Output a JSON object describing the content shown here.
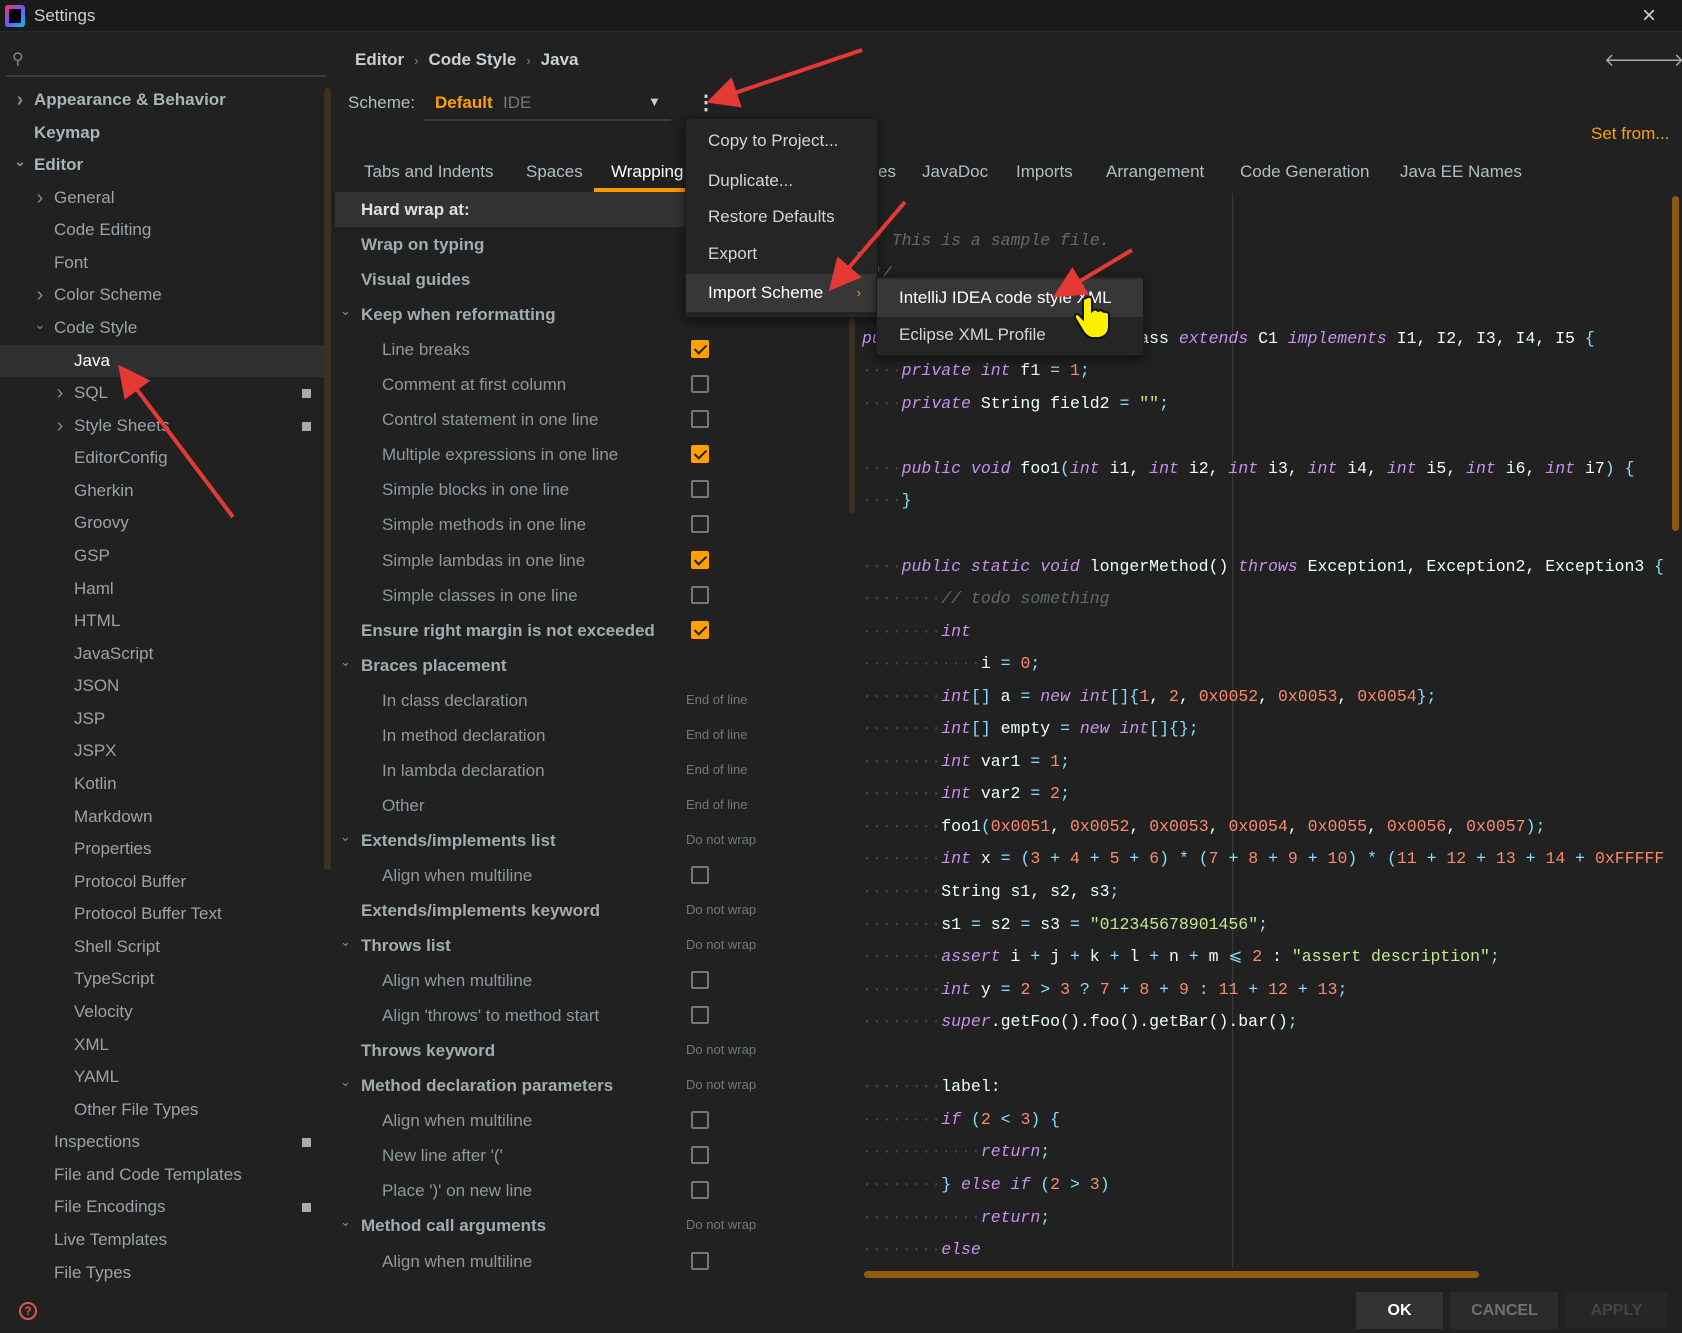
{
  "window": {
    "title": "Settings",
    "close_icon": "close-icon"
  },
  "breadcrumb": [
    "Editor",
    "Code Style",
    "Java"
  ],
  "sidebar": {
    "items": [
      {
        "label": "Appearance & Behavior",
        "level": 0,
        "arrow": "right",
        "bold": true
      },
      {
        "label": "Keymap",
        "level": 0,
        "bold": true
      },
      {
        "label": "Editor",
        "level": 0,
        "arrow": "down",
        "bold": true
      },
      {
        "label": "General",
        "level": 1,
        "arrow": "right"
      },
      {
        "label": "Code Editing",
        "level": 1
      },
      {
        "label": "Font",
        "level": 1
      },
      {
        "label": "Color Scheme",
        "level": 1,
        "arrow": "right"
      },
      {
        "label": "Code Style",
        "level": 1,
        "arrow": "down"
      },
      {
        "label": "Java",
        "level": 2,
        "selected": true
      },
      {
        "label": "SQL",
        "level": 2,
        "arrow": "right",
        "badge": true
      },
      {
        "label": "Style Sheets",
        "level": 2,
        "arrow": "right",
        "badge": true
      },
      {
        "label": "EditorConfig",
        "level": 2
      },
      {
        "label": "Gherkin",
        "level": 2
      },
      {
        "label": "Groovy",
        "level": 2
      },
      {
        "label": "GSP",
        "level": 2
      },
      {
        "label": "Haml",
        "level": 2
      },
      {
        "label": "HTML",
        "level": 2
      },
      {
        "label": "JavaScript",
        "level": 2
      },
      {
        "label": "JSON",
        "level": 2
      },
      {
        "label": "JSP",
        "level": 2
      },
      {
        "label": "JSPX",
        "level": 2
      },
      {
        "label": "Kotlin",
        "level": 2
      },
      {
        "label": "Markdown",
        "level": 2
      },
      {
        "label": "Properties",
        "level": 2
      },
      {
        "label": "Protocol Buffer",
        "level": 2
      },
      {
        "label": "Protocol Buffer Text",
        "level": 2
      },
      {
        "label": "Shell Script",
        "level": 2
      },
      {
        "label": "TypeScript",
        "level": 2
      },
      {
        "label": "Velocity",
        "level": 2
      },
      {
        "label": "XML",
        "level": 2
      },
      {
        "label": "YAML",
        "level": 2
      },
      {
        "label": "Other File Types",
        "level": 2
      },
      {
        "label": "Inspections",
        "level": 1,
        "badge": true
      },
      {
        "label": "File and Code Templates",
        "level": 1
      },
      {
        "label": "File Encodings",
        "level": 1,
        "badge": true
      },
      {
        "label": "Live Templates",
        "level": 1
      },
      {
        "label": "File Types",
        "level": 1
      }
    ]
  },
  "scheme": {
    "label": "Scheme:",
    "name": "Default",
    "type": "IDE",
    "set_from": "Set from..."
  },
  "tabs": [
    {
      "label": "Tabs and Indents"
    },
    {
      "label": "Spaces"
    },
    {
      "label": "Wrapping",
      "active": true
    },
    {
      "label": "es"
    },
    {
      "label": "JavaDoc"
    },
    {
      "label": "Imports"
    },
    {
      "label": "Arrangement"
    },
    {
      "label": "Code Generation"
    },
    {
      "label": "Java EE Names"
    }
  ],
  "options": [
    {
      "label": "Hard wrap at:",
      "bold": true,
      "highlight": true
    },
    {
      "label": "Wrap on typing",
      "bold": true
    },
    {
      "label": "Visual guides",
      "bold": true
    },
    {
      "label": "Keep when reformatting",
      "bold": true,
      "arrow": true
    },
    {
      "label": "Line breaks",
      "child": true,
      "checked": true
    },
    {
      "label": "Comment at first column",
      "child": true,
      "checked": false
    },
    {
      "label": "Control statement in one line",
      "child": true,
      "checked": false
    },
    {
      "label": "Multiple expressions in one line",
      "child": true,
      "checked": true
    },
    {
      "label": "Simple blocks in one line",
      "child": true,
      "checked": false
    },
    {
      "label": "Simple methods in one line",
      "child": true,
      "checked": false
    },
    {
      "label": "Simple lambdas in one line",
      "child": true,
      "checked": true
    },
    {
      "label": "Simple classes in one line",
      "child": true,
      "checked": false
    },
    {
      "label": "Ensure right margin is not exceeded",
      "bold": true,
      "checked": true
    },
    {
      "label": "Braces placement",
      "bold": true,
      "arrow": true
    },
    {
      "label": "In class declaration",
      "child": true,
      "value": "End of line"
    },
    {
      "label": "In method declaration",
      "child": true,
      "value": "End of line"
    },
    {
      "label": "In lambda declaration",
      "child": true,
      "value": "End of line"
    },
    {
      "label": "Other",
      "child": true,
      "value": "End of line"
    },
    {
      "label": "Extends/implements list",
      "bold": true,
      "arrow": true,
      "value": "Do not wrap"
    },
    {
      "label": "Align when multiline",
      "child": true,
      "checked": false
    },
    {
      "label": "Extends/implements keyword",
      "bold": true,
      "value": "Do not wrap"
    },
    {
      "label": "Throws list",
      "bold": true,
      "arrow": true,
      "value": "Do not wrap"
    },
    {
      "label": "Align when multiline",
      "child": true,
      "checked": false
    },
    {
      "label": "Align 'throws' to method start",
      "child": true,
      "checked": false
    },
    {
      "label": "Throws keyword",
      "bold": true,
      "value": "Do not wrap"
    },
    {
      "label": "Method declaration parameters",
      "bold": true,
      "arrow": true,
      "value": "Do not wrap"
    },
    {
      "label": "Align when multiline",
      "child": true,
      "checked": false
    },
    {
      "label": "New line after '('",
      "child": true,
      "checked": false
    },
    {
      "label": "Place ')' on new line",
      "child": true,
      "checked": false
    },
    {
      "label": "Method call arguments",
      "bold": true,
      "arrow": true,
      "value": "Do not wrap"
    },
    {
      "label": "Align when multiline",
      "child": true,
      "checked": false
    }
  ],
  "scheme_menu": {
    "items": [
      {
        "label": "Copy to Project..."
      },
      {
        "label": "Duplicate..."
      },
      {
        "label": "Restore Defaults"
      },
      {
        "label": "Export",
        "submenu": true
      },
      {
        "label": "Import Scheme",
        "submenu": true,
        "highlight": true
      }
    ]
  },
  "import_submenu": {
    "items": [
      {
        "label": "IntelliJ IDEA code style XML",
        "highlight": true
      },
      {
        "label": "Eclipse XML Profile"
      }
    ]
  },
  "code_lines": [
    [
      [
        "d",
        " "
      ],
      [
        "c",
        "* This is a sample file."
      ]
    ],
    [
      [
        "d",
        " "
      ],
      [
        "c",
        "*/"
      ]
    ],
    [],
    [
      [
        "kw",
        "public class"
      ],
      [
        "t",
        " ThisIsASampleClass "
      ],
      [
        "kw",
        "extends"
      ],
      [
        "t",
        " C1 "
      ],
      [
        "kw",
        "implements"
      ],
      [
        "t",
        " I1, I2, I3, I4, I5 "
      ],
      [
        "p",
        "{"
      ]
    ],
    [
      [
        "d",
        "····"
      ],
      [
        "kw",
        "private int"
      ],
      [
        "t",
        " f1 "
      ],
      [
        "p",
        "="
      ],
      [
        "t",
        " "
      ],
      [
        "num",
        "1"
      ],
      [
        "p",
        ";"
      ]
    ],
    [
      [
        "d",
        "····"
      ],
      [
        "kw",
        "private"
      ],
      [
        "t",
        " String field2 "
      ],
      [
        "p",
        "="
      ],
      [
        "t",
        " "
      ],
      [
        "s",
        "\"\""
      ],
      [
        "p",
        ";"
      ]
    ],
    [],
    [
      [
        "d",
        "····"
      ],
      [
        "kw",
        "public void"
      ],
      [
        "t",
        " foo1"
      ],
      [
        "p",
        "("
      ],
      [
        "kw",
        "int"
      ],
      [
        "t",
        " i1, "
      ],
      [
        "kw",
        "int"
      ],
      [
        "t",
        " i2, "
      ],
      [
        "kw",
        "int"
      ],
      [
        "t",
        " i3, "
      ],
      [
        "kw",
        "int"
      ],
      [
        "t",
        " i4, "
      ],
      [
        "kw",
        "int"
      ],
      [
        "t",
        " i5, "
      ],
      [
        "kw",
        "int"
      ],
      [
        "t",
        " i6, "
      ],
      [
        "kw",
        "int"
      ],
      [
        "t",
        " i7"
      ],
      [
        "p",
        ") {"
      ]
    ],
    [
      [
        "d",
        "····"
      ],
      [
        "p",
        "}"
      ]
    ],
    [],
    [
      [
        "d",
        "····"
      ],
      [
        "kw",
        "public static void"
      ],
      [
        "t",
        " longerMethod() "
      ],
      [
        "kw",
        "throws"
      ],
      [
        "t",
        " Exception1, Exception2, Exception3 "
      ],
      [
        "p",
        "{"
      ]
    ],
    [
      [
        "d",
        "········"
      ],
      [
        "c",
        "// todo something"
      ]
    ],
    [
      [
        "d",
        "········"
      ],
      [
        "kw",
        "int"
      ]
    ],
    [
      [
        "d",
        "············"
      ],
      [
        "t",
        "i "
      ],
      [
        "p",
        "="
      ],
      [
        "t",
        " "
      ],
      [
        "num",
        "0"
      ],
      [
        "p",
        ";"
      ]
    ],
    [
      [
        "d",
        "········"
      ],
      [
        "kw",
        "int"
      ],
      [
        "p",
        "[]"
      ],
      [
        "t",
        " a "
      ],
      [
        "p",
        "="
      ],
      [
        "t",
        " "
      ],
      [
        "kw",
        "new int"
      ],
      [
        "p",
        "[]{"
      ],
      [
        "num",
        "1"
      ],
      [
        "t",
        ", "
      ],
      [
        "num",
        "2"
      ],
      [
        "t",
        ", "
      ],
      [
        "num",
        "0x0052"
      ],
      [
        "t",
        ", "
      ],
      [
        "num",
        "0x0053"
      ],
      [
        "t",
        ", "
      ],
      [
        "num",
        "0x0054"
      ],
      [
        "p",
        "};"
      ]
    ],
    [
      [
        "d",
        "········"
      ],
      [
        "kw",
        "int"
      ],
      [
        "p",
        "[]"
      ],
      [
        "t",
        " empty "
      ],
      [
        "p",
        "="
      ],
      [
        "t",
        " "
      ],
      [
        "kw",
        "new int"
      ],
      [
        "p",
        "[]{};"
      ]
    ],
    [
      [
        "d",
        "········"
      ],
      [
        "kw",
        "int"
      ],
      [
        "t",
        " var1 "
      ],
      [
        "p",
        "="
      ],
      [
        "t",
        " "
      ],
      [
        "num",
        "1"
      ],
      [
        "p",
        ";"
      ]
    ],
    [
      [
        "d",
        "········"
      ],
      [
        "kw",
        "int"
      ],
      [
        "t",
        " var2 "
      ],
      [
        "p",
        "="
      ],
      [
        "t",
        " "
      ],
      [
        "num",
        "2"
      ],
      [
        "p",
        ";"
      ]
    ],
    [
      [
        "d",
        "········"
      ],
      [
        "t",
        "foo1"
      ],
      [
        "p",
        "("
      ],
      [
        "num",
        "0x0051"
      ],
      [
        "t",
        ", "
      ],
      [
        "num",
        "0x0052"
      ],
      [
        "t",
        ", "
      ],
      [
        "num",
        "0x0053"
      ],
      [
        "t",
        ", "
      ],
      [
        "num",
        "0x0054"
      ],
      [
        "t",
        ", "
      ],
      [
        "num",
        "0x0055"
      ],
      [
        "t",
        ", "
      ],
      [
        "num",
        "0x0056"
      ],
      [
        "t",
        ", "
      ],
      [
        "num",
        "0x0057"
      ],
      [
        "p",
        ");"
      ]
    ],
    [
      [
        "d",
        "········"
      ],
      [
        "kw",
        "int"
      ],
      [
        "t",
        " x "
      ],
      [
        "p",
        "= ("
      ],
      [
        "num",
        "3"
      ],
      [
        "p",
        " + "
      ],
      [
        "num",
        "4"
      ],
      [
        "p",
        " + "
      ],
      [
        "num",
        "5"
      ],
      [
        "p",
        " + "
      ],
      [
        "num",
        "6"
      ],
      [
        "p",
        ") * ("
      ],
      [
        "num",
        "7"
      ],
      [
        "p",
        " + "
      ],
      [
        "num",
        "8"
      ],
      [
        "p",
        " + "
      ],
      [
        "num",
        "9"
      ],
      [
        "p",
        " + "
      ],
      [
        "num",
        "10"
      ],
      [
        "p",
        ") * ("
      ],
      [
        "num",
        "11"
      ],
      [
        "p",
        " + "
      ],
      [
        "num",
        "12"
      ],
      [
        "p",
        " + "
      ],
      [
        "num",
        "13"
      ],
      [
        "p",
        " + "
      ],
      [
        "num",
        "14"
      ],
      [
        "p",
        " + "
      ],
      [
        "num",
        "0xFFFFF"
      ]
    ],
    [
      [
        "d",
        "········"
      ],
      [
        "t",
        "String s1, s2, s3"
      ],
      [
        "p",
        ";"
      ]
    ],
    [
      [
        "d",
        "········"
      ],
      [
        "t",
        "s1 "
      ],
      [
        "p",
        "="
      ],
      [
        "t",
        " s2 "
      ],
      [
        "p",
        "="
      ],
      [
        "t",
        " s3 "
      ],
      [
        "p",
        "="
      ],
      [
        "t",
        " "
      ],
      [
        "s",
        "\"012345678901456\""
      ],
      [
        "p",
        ";"
      ]
    ],
    [
      [
        "d",
        "········"
      ],
      [
        "kw",
        "assert"
      ],
      [
        "t",
        " i "
      ],
      [
        "p",
        "+"
      ],
      [
        "t",
        " j "
      ],
      [
        "p",
        "+"
      ],
      [
        "t",
        " k "
      ],
      [
        "p",
        "+"
      ],
      [
        "t",
        " l "
      ],
      [
        "p",
        "+"
      ],
      [
        "t",
        " n "
      ],
      [
        "p",
        "+"
      ],
      [
        "t",
        " m "
      ],
      [
        "p",
        "⩽"
      ],
      [
        "t",
        " "
      ],
      [
        "num",
        "2"
      ],
      [
        "t",
        " : "
      ],
      [
        "s",
        "\"assert description\""
      ],
      [
        "p",
        ";"
      ]
    ],
    [
      [
        "d",
        "········"
      ],
      [
        "kw",
        "int"
      ],
      [
        "t",
        " y "
      ],
      [
        "p",
        "="
      ],
      [
        "t",
        " "
      ],
      [
        "num",
        "2"
      ],
      [
        "p",
        " > "
      ],
      [
        "num",
        "3"
      ],
      [
        "p",
        " ? "
      ],
      [
        "num",
        "7"
      ],
      [
        "p",
        " + "
      ],
      [
        "num",
        "8"
      ],
      [
        "p",
        " + "
      ],
      [
        "num",
        "9"
      ],
      [
        "p",
        " : "
      ],
      [
        "num",
        "11"
      ],
      [
        "p",
        " + "
      ],
      [
        "num",
        "12"
      ],
      [
        "p",
        " + "
      ],
      [
        "num",
        "13"
      ],
      [
        "p",
        ";"
      ]
    ],
    [
      [
        "d",
        "········"
      ],
      [
        "kw",
        "super"
      ],
      [
        "t",
        ".getFoo().foo().getBar().bar()"
      ],
      [
        "p",
        ";"
      ]
    ],
    [],
    [
      [
        "d",
        "········"
      ],
      [
        "t",
        "label:"
      ]
    ],
    [
      [
        "d",
        "········"
      ],
      [
        "kw",
        "if"
      ],
      [
        "t",
        " "
      ],
      [
        "p",
        "("
      ],
      [
        "num",
        "2"
      ],
      [
        "p",
        " < "
      ],
      [
        "num",
        "3"
      ],
      [
        "p",
        ") {"
      ]
    ],
    [
      [
        "d",
        "············"
      ],
      [
        "kw",
        "return"
      ],
      [
        "p",
        ";"
      ]
    ],
    [
      [
        "d",
        "········"
      ],
      [
        "p",
        "} "
      ],
      [
        "kw",
        "else if"
      ],
      [
        "t",
        " "
      ],
      [
        "p",
        "("
      ],
      [
        "num",
        "2"
      ],
      [
        "p",
        " > "
      ],
      [
        "num",
        "3"
      ],
      [
        "p",
        ")"
      ]
    ],
    [
      [
        "d",
        "············"
      ],
      [
        "kw",
        "return"
      ],
      [
        "p",
        ";"
      ]
    ],
    [
      [
        "d",
        "········"
      ],
      [
        "kw",
        "else"
      ]
    ]
  ],
  "buttons": {
    "ok": "OK",
    "cancel": "CANCEL",
    "apply": "APPLY"
  },
  "colors": {
    "accent": "#ffa000",
    "background": "#212121",
    "annotation": "#e53935",
    "keyword": "#c792ea",
    "number": "#f78c6c",
    "string": "#c3e88d"
  }
}
